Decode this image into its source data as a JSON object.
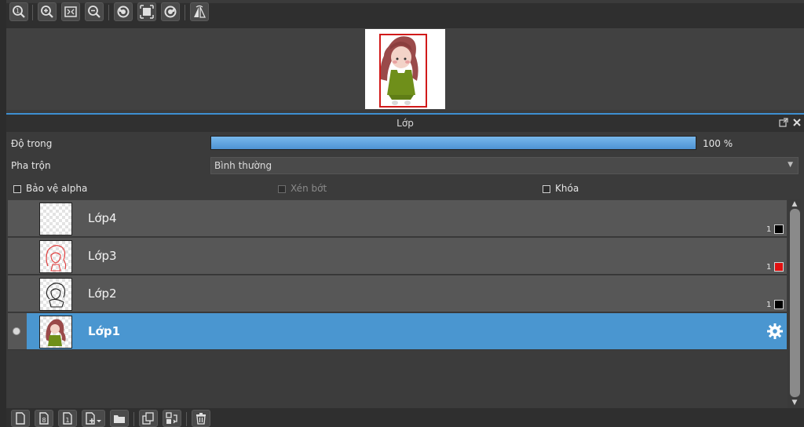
{
  "toolbar": {
    "buttons": [
      "zoom-actual-icon",
      "zoom-in-icon",
      "fit-window-icon",
      "zoom-out-icon",
      "rotate-left-icon",
      "fit-frame-icon",
      "rotate-right-icon",
      "flip-icon"
    ]
  },
  "panel": {
    "title": "Lớp"
  },
  "properties": {
    "opacity_label": "Độ trong",
    "opacity_value": 100,
    "opacity_text": "100 %",
    "blend_label": "Pha trộn",
    "blend_value": "Bình thường"
  },
  "checks": {
    "alpha_protect": "Bảo vệ alpha",
    "clipping": "Xén bớt",
    "lock": "Khóa"
  },
  "layers": [
    {
      "name": "Lớp4",
      "count": "1",
      "color": "#000000",
      "selected": false,
      "thumb": "blank"
    },
    {
      "name": "Lớp3",
      "count": "1",
      "color": "#e01010",
      "selected": false,
      "thumb": "red-sketch"
    },
    {
      "name": "Lớp2",
      "count": "1",
      "color": "#000000",
      "selected": false,
      "thumb": "black-sketch"
    },
    {
      "name": "Lớp1",
      "count": "",
      "color": "",
      "selected": true,
      "thumb": "colored"
    }
  ],
  "colors": {
    "accent": "#4a96d0",
    "opacity_bar": "#78b8ec",
    "nav_frame": "#d11a1a"
  },
  "bottom_toolbar": {
    "buttons": [
      "new-layer-icon",
      "new-8bit-layer-icon",
      "new-1bit-layer-icon",
      "add-layer-menu-icon",
      "new-folder-icon",
      "duplicate-layer-icon",
      "merge-down-icon",
      "delete-layer-icon"
    ]
  }
}
